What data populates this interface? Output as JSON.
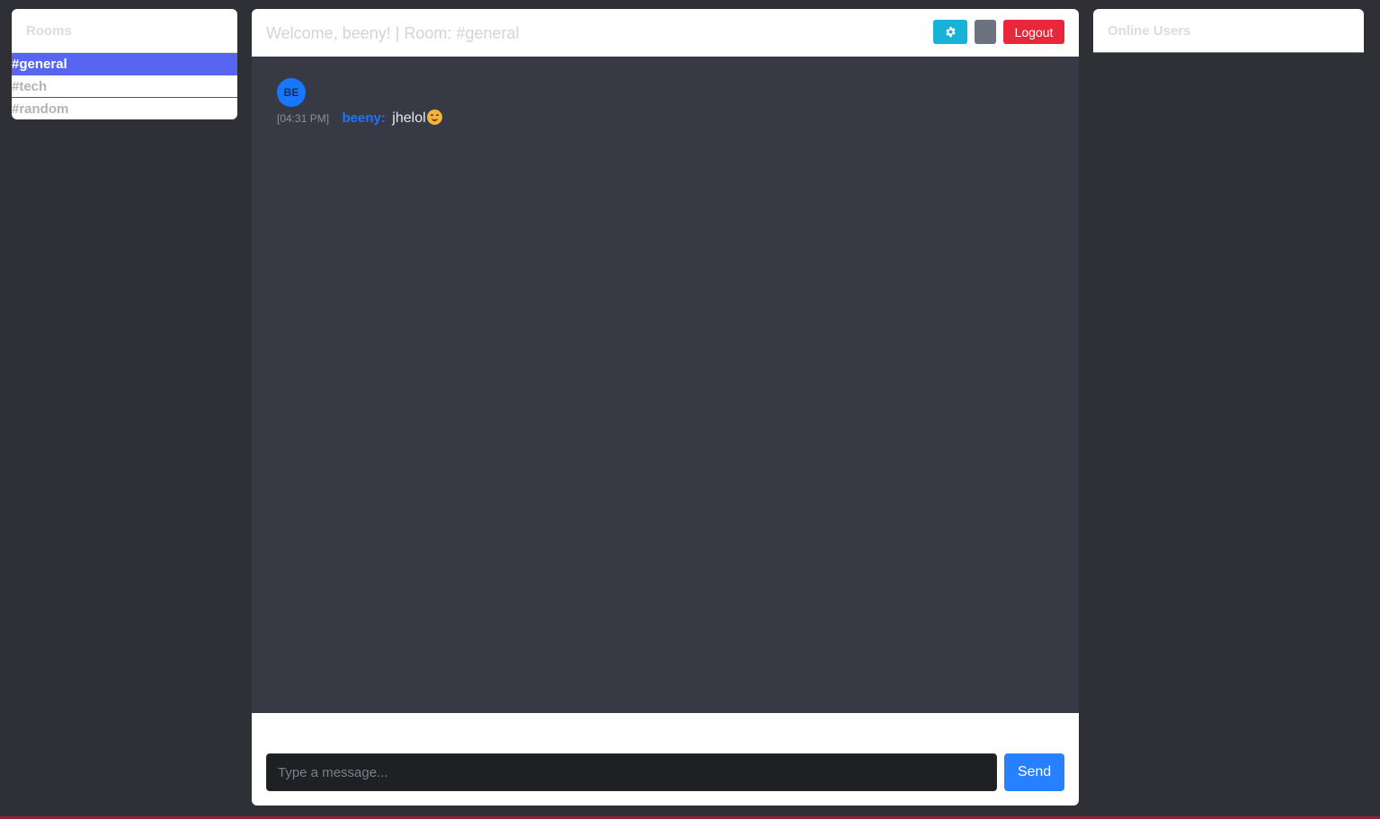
{
  "rooms": {
    "title": "Rooms",
    "items": [
      {
        "label": "#general",
        "active": true
      },
      {
        "label": "#tech",
        "active": false
      },
      {
        "label": "#random",
        "active": false
      }
    ]
  },
  "chat": {
    "title": "Welcome, beeny! | Room: #general",
    "settings_icon": "gear-icon",
    "logout_label": "Logout"
  },
  "messages": [
    {
      "avatar_initials": "BE",
      "time": "[04:31 PM]",
      "user": "beeny:",
      "text": "jhelol",
      "emoji": "smiling-face-icon"
    }
  ],
  "input": {
    "placeholder": "Type a message...",
    "value": "",
    "send_label": "Send"
  },
  "online_users": {
    "title": "Online Users",
    "users": []
  },
  "colors": {
    "accent": "#5865f2",
    "settings": "#17b2d6",
    "logout": "#e8273a",
    "send": "#2680ff",
    "username": "#1e74ff"
  }
}
